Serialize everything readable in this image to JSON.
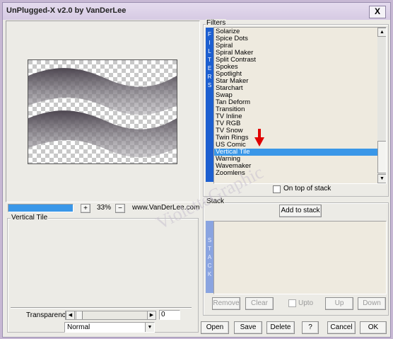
{
  "window": {
    "title": "UnPlugged-X v2.0 by VanDerLee",
    "close_glyph": "X"
  },
  "preview": {
    "zoom_in_label": "+",
    "zoom_value": "33%",
    "zoom_out_label": "−",
    "website": "www.VanDerLee.com"
  },
  "filter_panel": {
    "group_label": "Filters",
    "side_tab_label": "FILTERS",
    "items": [
      "Solarize",
      "Spice Dots",
      "Spiral",
      "Spiral Maker",
      "Split Contrast",
      "Spokes",
      "Spotlight",
      "Star Maker",
      "Starchart",
      "Swap",
      "Tan Deform",
      "Transition",
      "TV Inline",
      "TV RGB",
      "TV Snow",
      "Twin Rings",
      "US Comic",
      "Vertical Tile",
      "Warning",
      "Wavemaker",
      "Zoomlens"
    ],
    "selected": "Vertical Tile",
    "on_top_label": "On top of stack"
  },
  "settings": {
    "group_label": "Vertical Tile",
    "transparency_label": "Transparency",
    "transparency_value": "0",
    "blend_mode": "Normal"
  },
  "stack": {
    "group_label": "Stack",
    "side_tab_label": "STACK",
    "add_label": "Add to stack",
    "remove_label": "Remove",
    "clear_label": "Clear",
    "upto_label": "Upto",
    "up_label": "Up",
    "down_label": "Down"
  },
  "footer": {
    "open_label": "Open",
    "save_label": "Save",
    "delete_label": "Delete",
    "help_label": "?",
    "cancel_label": "Cancel",
    "ok_label": "OK"
  },
  "watermark": "VioletteGraphic",
  "colors": {
    "accent": "#1d5fd0",
    "selection": "#3a97e8",
    "arrow": "#e00000"
  }
}
